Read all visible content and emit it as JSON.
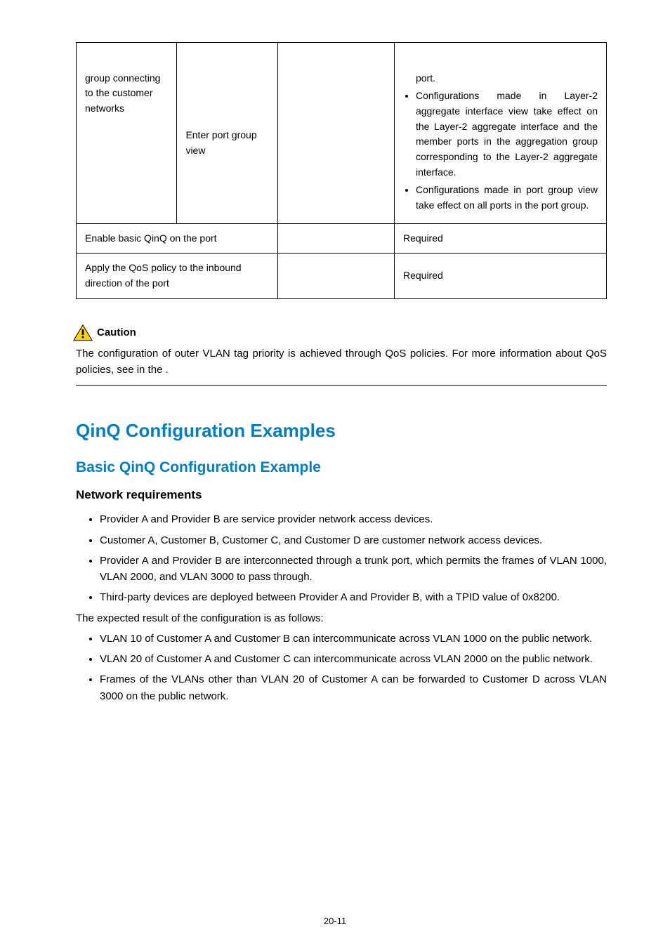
{
  "table": {
    "row1": {
      "c1": "group connecting to the customer networks",
      "c2": "Enter port group view",
      "c3": "",
      "c4pre": "port.",
      "c4li1": "Configurations made in Layer-2 aggregate interface view take effect on the Layer-2 aggregate interface and the member ports in the aggregation group corresponding to the Layer-2 aggregate interface.",
      "c4li2": "Configurations made in port group view take effect on all ports in the port group."
    },
    "row2": {
      "c12": "Enable basic QinQ on the port",
      "c3": "",
      "c4": "Required"
    },
    "row3": {
      "c12": "Apply the QoS policy to the inbound direction of the port",
      "c3": "",
      "c4": "Required"
    }
  },
  "caution": {
    "label": "Caution",
    "text_a": "The configuration of outer VLAN tag priority is achieved through QoS policies. For more information about QoS policies, see ",
    "text_b": " in the ",
    "text_c": "."
  },
  "h1": "QinQ Configuration Examples",
  "h2": "Basic QinQ Configuration Example",
  "h3": "Network requirements",
  "list1": {
    "li1": "Provider A and Provider B are service provider network access devices.",
    "li2": "Customer A, Customer B, Customer C, and Customer D are customer network access devices.",
    "li3": "Provider A and Provider B are interconnected through a trunk port, which permits the frames of VLAN 1000, VLAN 2000, and VLAN 3000 to pass through.",
    "li4": "Third-party devices are deployed between Provider A and Provider B, with a TPID value of 0x8200."
  },
  "mid_p": "The expected result of the configuration is as follows:",
  "list2": {
    "li1": "VLAN 10 of Customer A and Customer B can intercommunicate across VLAN 1000 on the public network.",
    "li2": "VLAN 20 of Customer A and Customer C can intercommunicate across VLAN 2000 on the public network.",
    "li3": "Frames of the VLANs other than VLAN 20 of Customer A can be forwarded to Customer D across VLAN 3000 on the public network."
  },
  "pagenum": "20-11"
}
